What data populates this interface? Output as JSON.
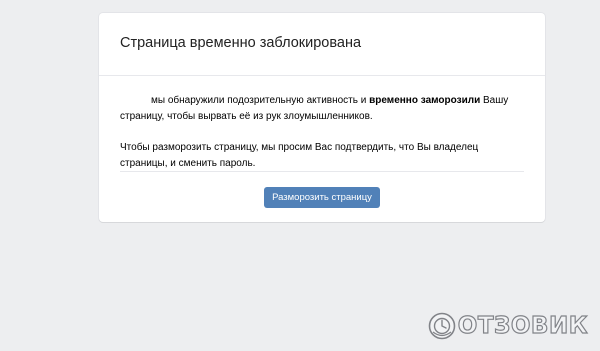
{
  "page": {
    "title": "Страница временно заблокирована"
  },
  "message": {
    "p1_part1": "мы обнаружили подозрительную активность и ",
    "p1_bold": "временно заморозили",
    "p1_part2": " Вашу страницу, чтобы вырвать её из рук злоумышленников.",
    "p2": "Чтобы разморозить страницу, мы просим Вас подтвердить, что Вы владелец страницы, и сменить пароль."
  },
  "actions": {
    "unfreeze_label": "Разморозить страницу"
  },
  "watermark": {
    "text": "ОТЗОВИК"
  },
  "colors": {
    "background": "#edeef0",
    "card": "#ffffff",
    "button": "#5181b8",
    "button_text": "#ffffff"
  }
}
